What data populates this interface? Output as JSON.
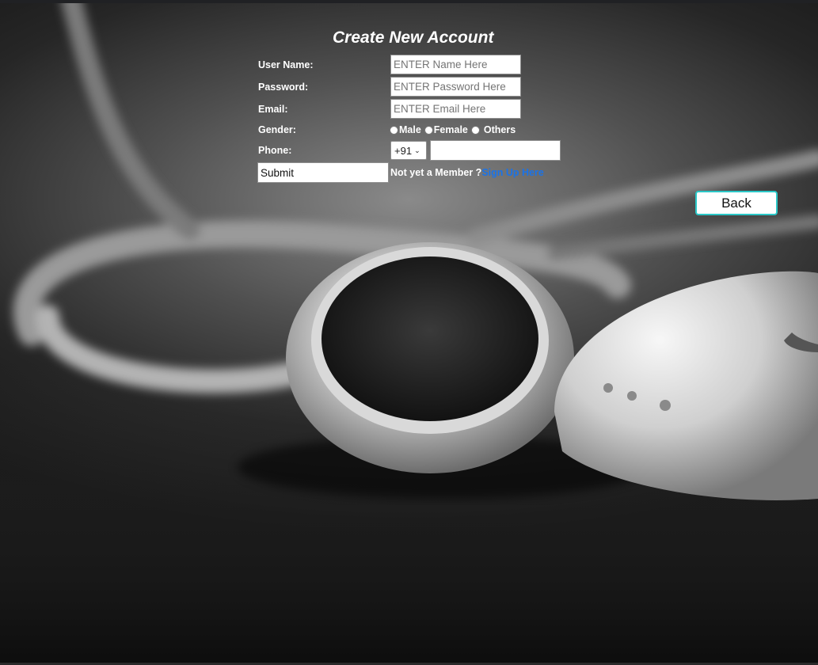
{
  "form": {
    "title": "Create New Account",
    "username": {
      "label": "User Name:",
      "placeholder": "ENTER Name Here"
    },
    "password": {
      "label": "Password:",
      "placeholder": "ENTER Password Here"
    },
    "email": {
      "label": "Email:",
      "placeholder": "ENTER Email Here"
    },
    "gender": {
      "label": "Gender:",
      "options": [
        "Male",
        "Female",
        "Others"
      ]
    },
    "phone": {
      "label": "Phone:",
      "country_code": "+91",
      "value": ""
    },
    "submit_label": "Submit",
    "member_text": "Not yet a Member ?",
    "signup_link": "Sign Up Here"
  },
  "back_label": "Back",
  "colors": {
    "link": "#1a73e8",
    "back_border": "#2bc7c7",
    "text": "#ffffff"
  },
  "background": {
    "image": "grayscale-earphones-photo"
  }
}
